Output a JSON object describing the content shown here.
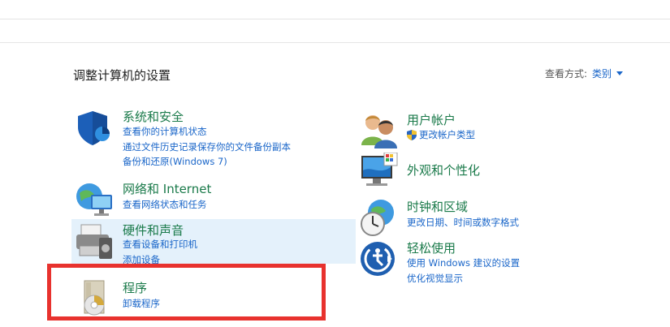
{
  "page_title": "调整计算机的设置",
  "view_by": {
    "label": "查看方式:",
    "value": "类别"
  },
  "left_categories": [
    {
      "title": "系统和安全",
      "links": [
        "查看你的计算机状态",
        "通过文件历史记录保存你的文件备份副本",
        "备份和还原(Windows 7)"
      ]
    },
    {
      "title": "网络和 Internet",
      "links": [
        "查看网络状态和任务"
      ]
    },
    {
      "title": "硬件和声音",
      "links": [
        "查看设备和打印机",
        "添加设备"
      ]
    },
    {
      "title": "程序",
      "links": [
        "卸载程序"
      ]
    }
  ],
  "right_categories": [
    {
      "title": "用户帐户",
      "links": [
        "更改帐户类型"
      ]
    },
    {
      "title": "外观和个性化",
      "links": []
    },
    {
      "title": "时钟和区域",
      "links": [
        "更改日期、时间或数字格式"
      ]
    },
    {
      "title": "轻松使用",
      "links": [
        "使用 Windows 建议的设置",
        "优化视觉显示"
      ]
    }
  ],
  "colors": {
    "link": "#1a66c9",
    "category_title": "#1a7a4a",
    "highlight": "#e4f1fb",
    "annotation_box": "#e8322e"
  }
}
